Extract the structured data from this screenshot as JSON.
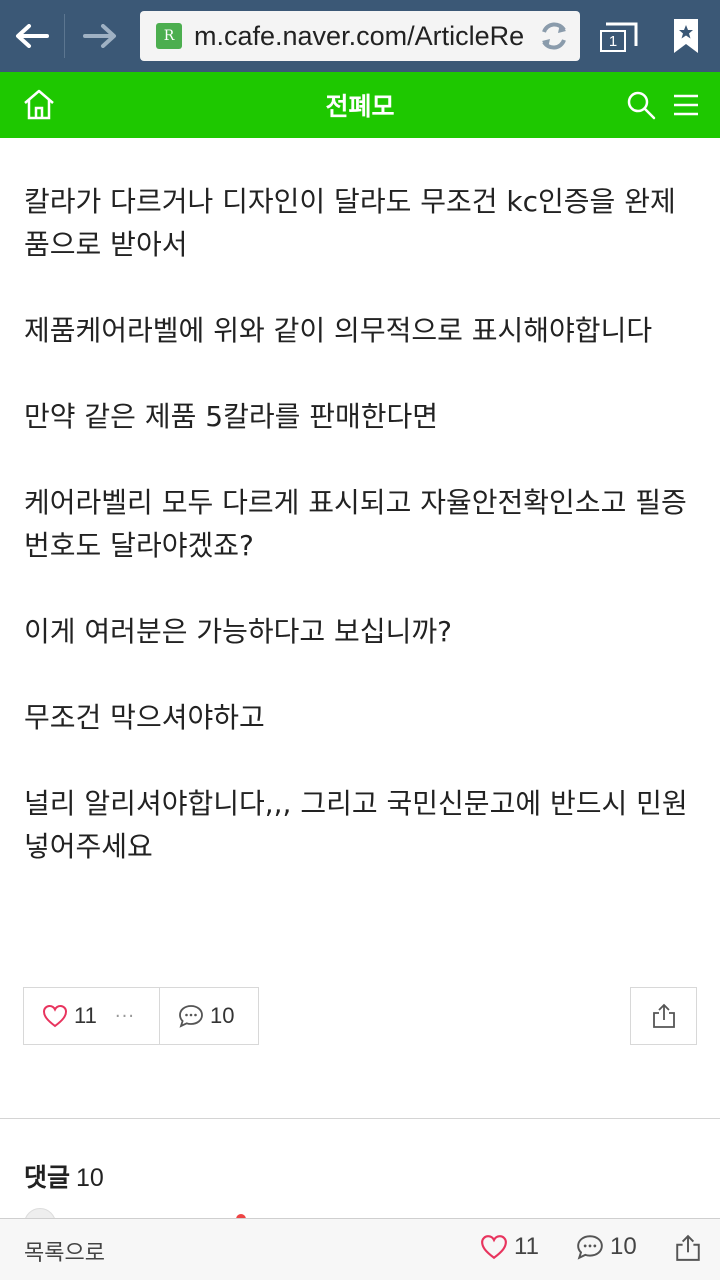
{
  "browser": {
    "url": "m.cafe.naver.com/ArticleRe",
    "favicon_letter": "R",
    "tab_count": "1",
    "bar_color": "#3b5876"
  },
  "cafe": {
    "title": "전폐모",
    "header_color": "#1ec800"
  },
  "article": {
    "paragraphs": [
      "칼라가 다르거나 디자인이 달라도  무조건 kc인증을 완제품으로 받아서",
      "제품케어라벨에 위와 같이 의무적으로 표시해야합니다",
      "만약 같은 제품 5칼라를 판매한다면",
      "케어라벨리 모두 다르게 표시되고 자율안전확인소고 필증번호도 달라야겠죠?",
      "이게 여러분은 가능하다고 보십니까?",
      "무조건 막으셔야하고",
      "널리 알리셔야합니다,,, 그리고 국민신문고에 반드시 민원 넣어주세요"
    ]
  },
  "actions": {
    "like_count": "11",
    "more": "···",
    "comment_count": "10"
  },
  "comments": {
    "label": "댓글",
    "count": "10"
  },
  "bottom_bar": {
    "list_label": "목록으로",
    "like_count": "11",
    "comment_count": "10"
  },
  "icons": [
    "back-arrow-icon",
    "forward-arrow-icon",
    "reload-icon",
    "tabs-icon",
    "bookmark-icon",
    "home-icon",
    "search-icon",
    "menu-icon",
    "heart-icon",
    "comment-icon",
    "share-icon"
  ]
}
